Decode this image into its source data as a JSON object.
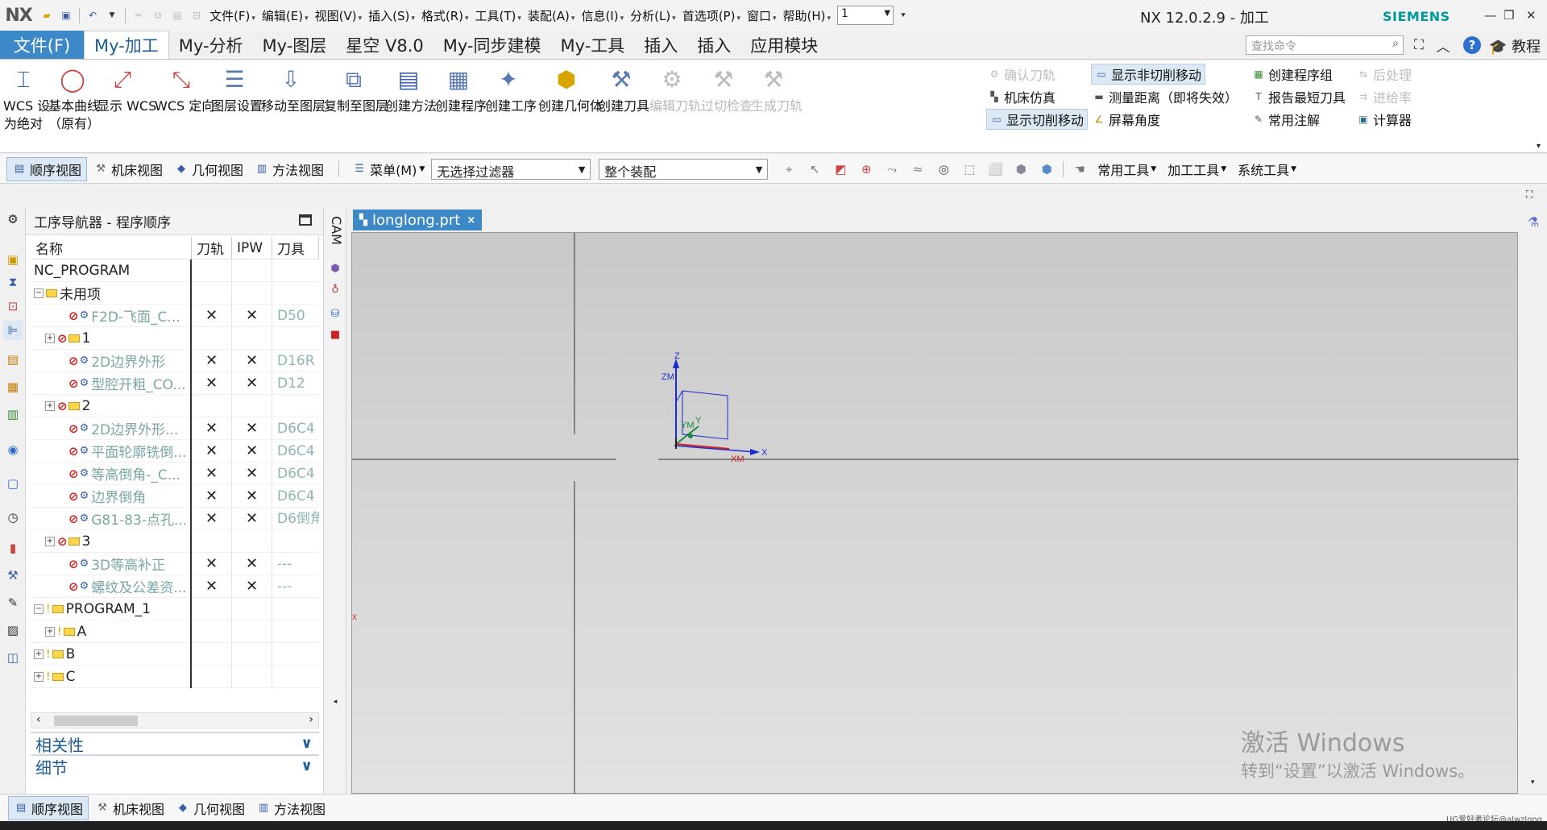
{
  "titlebar": {
    "logo": "NX",
    "menus": [
      {
        "label": "文件(F)"
      },
      {
        "label": "编辑(E)"
      },
      {
        "label": "视图(V)"
      },
      {
        "label": "插入(S)"
      },
      {
        "label": "格式(R)"
      },
      {
        "label": "工具(T)"
      },
      {
        "label": "装配(A)"
      },
      {
        "label": "信息(I)"
      },
      {
        "label": "分析(L)"
      },
      {
        "label": "首选项(P)"
      },
      {
        "label": "窗口"
      },
      {
        "label": "帮助(H)"
      }
    ],
    "window_combo": "1",
    "app_title": "NX 12.0.2.9 - 加工",
    "brand": "SIEMENS"
  },
  "ribbon": {
    "tabs": [
      "文件(F)",
      "My-加工",
      "My-分析",
      "My-图层",
      "星空 V8.0",
      "My-同步建模",
      "My-工具",
      "插入",
      "插入",
      "应用模块"
    ],
    "active_tab": "My-加工",
    "search_placeholder": "查找命令",
    "tutorial": "教程",
    "big_buttons": [
      {
        "l1": "WCS 设",
        "l2": "为绝对"
      },
      {
        "l1": "基本曲线",
        "l2": "（原有）"
      },
      {
        "l1": "显示 WCS",
        "l2": ""
      },
      {
        "l1": "WCS 定向",
        "l2": ""
      },
      {
        "l1": "图层设置",
        "l2": ""
      },
      {
        "l1": "移动至图层",
        "l2": ""
      },
      {
        "l1": "复制至图层",
        "l2": ""
      },
      {
        "l1": "创建方法",
        "l2": ""
      },
      {
        "l1": "创建程序",
        "l2": ""
      },
      {
        "l1": "创建工序",
        "l2": ""
      },
      {
        "l1": "创建几何体",
        "l2": ""
      },
      {
        "l1": "创建刀具",
        "l2": ""
      },
      {
        "l1": "编辑刀轨",
        "l2": ""
      },
      {
        "l1": "过切检查",
        "l2": ""
      },
      {
        "l1": "生成刀轨",
        "l2": ""
      }
    ],
    "small_buttons": {
      "col1": [
        "确认刀轨",
        "机床仿真",
        "显示切削移动"
      ],
      "col2": [
        "显示非切削移动",
        "测量距离（即将失效）",
        "屏幕角度"
      ],
      "col3": [
        "创建程序组",
        "报告最短刀具",
        "常用注解"
      ],
      "col4": [
        "后处理",
        "进给率",
        "计算器"
      ]
    }
  },
  "toolbar2": {
    "views": [
      "顺序视图",
      "机床视图",
      "几何视图",
      "方法视图"
    ],
    "menu_label": "菜单(M)",
    "filter_combo": "无选择过滤器",
    "scope_combo": "整个装配",
    "right_menus": [
      "常用工具",
      "加工工具",
      "系统工具"
    ]
  },
  "navigator": {
    "title": "工序导航器 - 程序顺序",
    "columns": [
      "名称",
      "刀轨",
      "IPW",
      "刀具"
    ],
    "rows": [
      {
        "indent": 0,
        "exp": "",
        "icon": "",
        "name": "NC_PROGRAM",
        "path": "",
        "ipw": "",
        "tool": "",
        "greyed": false
      },
      {
        "indent": 0,
        "exp": "−",
        "icon": "grp",
        "name": "未用项",
        "path": "",
        "ipw": "",
        "tool": "",
        "greyed": false
      },
      {
        "indent": 2,
        "exp": "",
        "icon": "op",
        "name": "F2D-飞面_C...",
        "path": "✕",
        "ipw": "✕",
        "tool": "D50",
        "greyed": true
      },
      {
        "indent": 1,
        "exp": "+",
        "icon": "grp",
        "name": "1",
        "path": "",
        "ipw": "",
        "tool": "",
        "greyed": false
      },
      {
        "indent": 2,
        "exp": "",
        "icon": "op",
        "name": "2D边界外形",
        "path": "✕",
        "ipw": "✕",
        "tool": "D16R",
        "greyed": true
      },
      {
        "indent": 2,
        "exp": "",
        "icon": "op",
        "name": "型腔开粗_CO...",
        "path": "✕",
        "ipw": "✕",
        "tool": "D12",
        "greyed": true
      },
      {
        "indent": 1,
        "exp": "+",
        "icon": "grp",
        "name": "2",
        "path": "",
        "ipw": "",
        "tool": "",
        "greyed": false
      },
      {
        "indent": 2,
        "exp": "",
        "icon": "op",
        "name": "2D边界外形...",
        "path": "✕",
        "ipw": "✕",
        "tool": "D6C4",
        "greyed": true
      },
      {
        "indent": 2,
        "exp": "",
        "icon": "op",
        "name": "平面轮廓铣倒...",
        "path": "✕",
        "ipw": "✕",
        "tool": "D6C4",
        "greyed": true
      },
      {
        "indent": 2,
        "exp": "",
        "icon": "op",
        "name": "等高倒角-_C...",
        "path": "✕",
        "ipw": "✕",
        "tool": "D6C4",
        "greyed": true
      },
      {
        "indent": 2,
        "exp": "",
        "icon": "op",
        "name": "边界倒角",
        "path": "✕",
        "ipw": "✕",
        "tool": "D6C4",
        "greyed": true
      },
      {
        "indent": 2,
        "exp": "",
        "icon": "op",
        "name": "G81-83-点孔...",
        "path": "✕",
        "ipw": "✕",
        "tool": "D6倒角",
        "greyed": true
      },
      {
        "indent": 1,
        "exp": "+",
        "icon": "grp",
        "name": "3",
        "path": "",
        "ipw": "",
        "tool": "",
        "greyed": false
      },
      {
        "indent": 2,
        "exp": "",
        "icon": "op",
        "name": "3D等高补正",
        "path": "✕",
        "ipw": "✕",
        "tool": "---",
        "greyed": true
      },
      {
        "indent": 2,
        "exp": "",
        "icon": "op",
        "name": "螺纹及公差资...",
        "path": "✕",
        "ipw": "✕",
        "tool": "---",
        "greyed": true
      },
      {
        "indent": 0,
        "exp": "−",
        "icon": "key",
        "name": "PROGRAM_1",
        "path": "",
        "ipw": "",
        "tool": "",
        "greyed": false
      },
      {
        "indent": 1,
        "exp": "+",
        "icon": "key",
        "name": "A",
        "path": "",
        "ipw": "",
        "tool": "",
        "greyed": false
      },
      {
        "indent": 0,
        "exp": "+",
        "icon": "key",
        "name": "B",
        "path": "",
        "ipw": "",
        "tool": "",
        "greyed": false
      },
      {
        "indent": 0,
        "exp": "+",
        "icon": "key",
        "name": "C",
        "path": "",
        "ipw": "",
        "tool": "",
        "greyed": false
      }
    ],
    "acc_relevance": "相关性",
    "acc_details": "细节"
  },
  "cam_label": "CAM",
  "graphics": {
    "file_tab": "longlong.prt",
    "axes": {
      "z": "Z",
      "zm": "ZM",
      "y": "Y",
      "ym": "YM",
      "x": "X",
      "xm": "XM"
    },
    "triad": {
      "z": "Z",
      "x": "X"
    }
  },
  "watermark": {
    "line1": "激活 Windows",
    "line2": "转到“设置”以激活 Windows。"
  },
  "corner_watermark": "UG爱好者论坛@alwzlong"
}
